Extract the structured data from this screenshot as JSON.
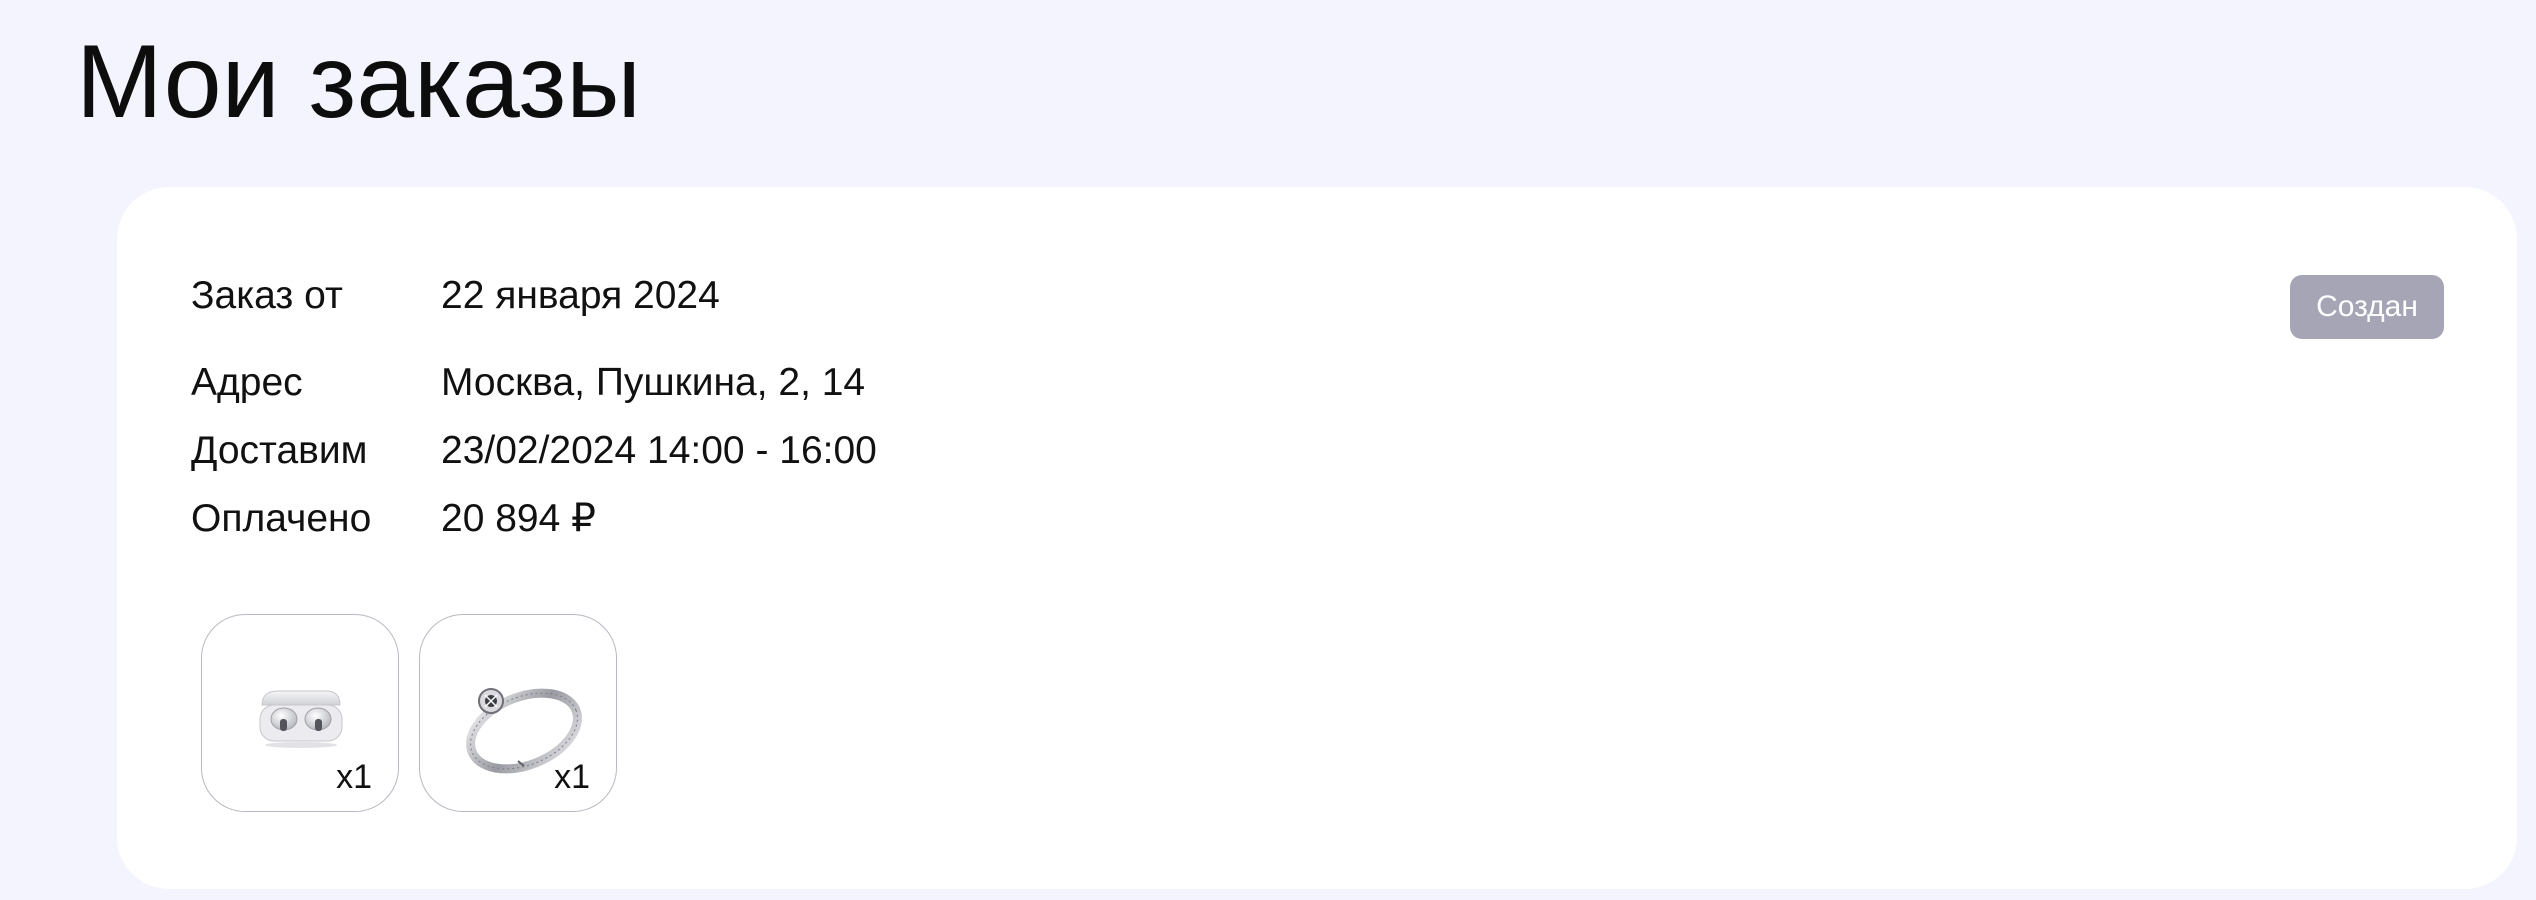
{
  "page": {
    "title": "Мои заказы"
  },
  "order": {
    "date_label": "Заказ от",
    "date_value": "22 января 2024",
    "address_label": "Адрес",
    "address_value": "Москва, Пушкина, 2, 14",
    "delivery_label": "Доставим",
    "delivery_value": "23/02/2024 14:00 - 16:00",
    "paid_label": "Оплачено",
    "paid_value": "20 894 ₽",
    "status": "Создан",
    "status_color": "#a6a5b5",
    "items": [
      {
        "icon": "earbuds-case-icon",
        "quantity": "x1"
      },
      {
        "icon": "diamond-ring-icon",
        "quantity": "x1"
      }
    ]
  },
  "colors": {
    "background": "#f4f4fe",
    "card": "#ffffff",
    "text": "#111111"
  }
}
